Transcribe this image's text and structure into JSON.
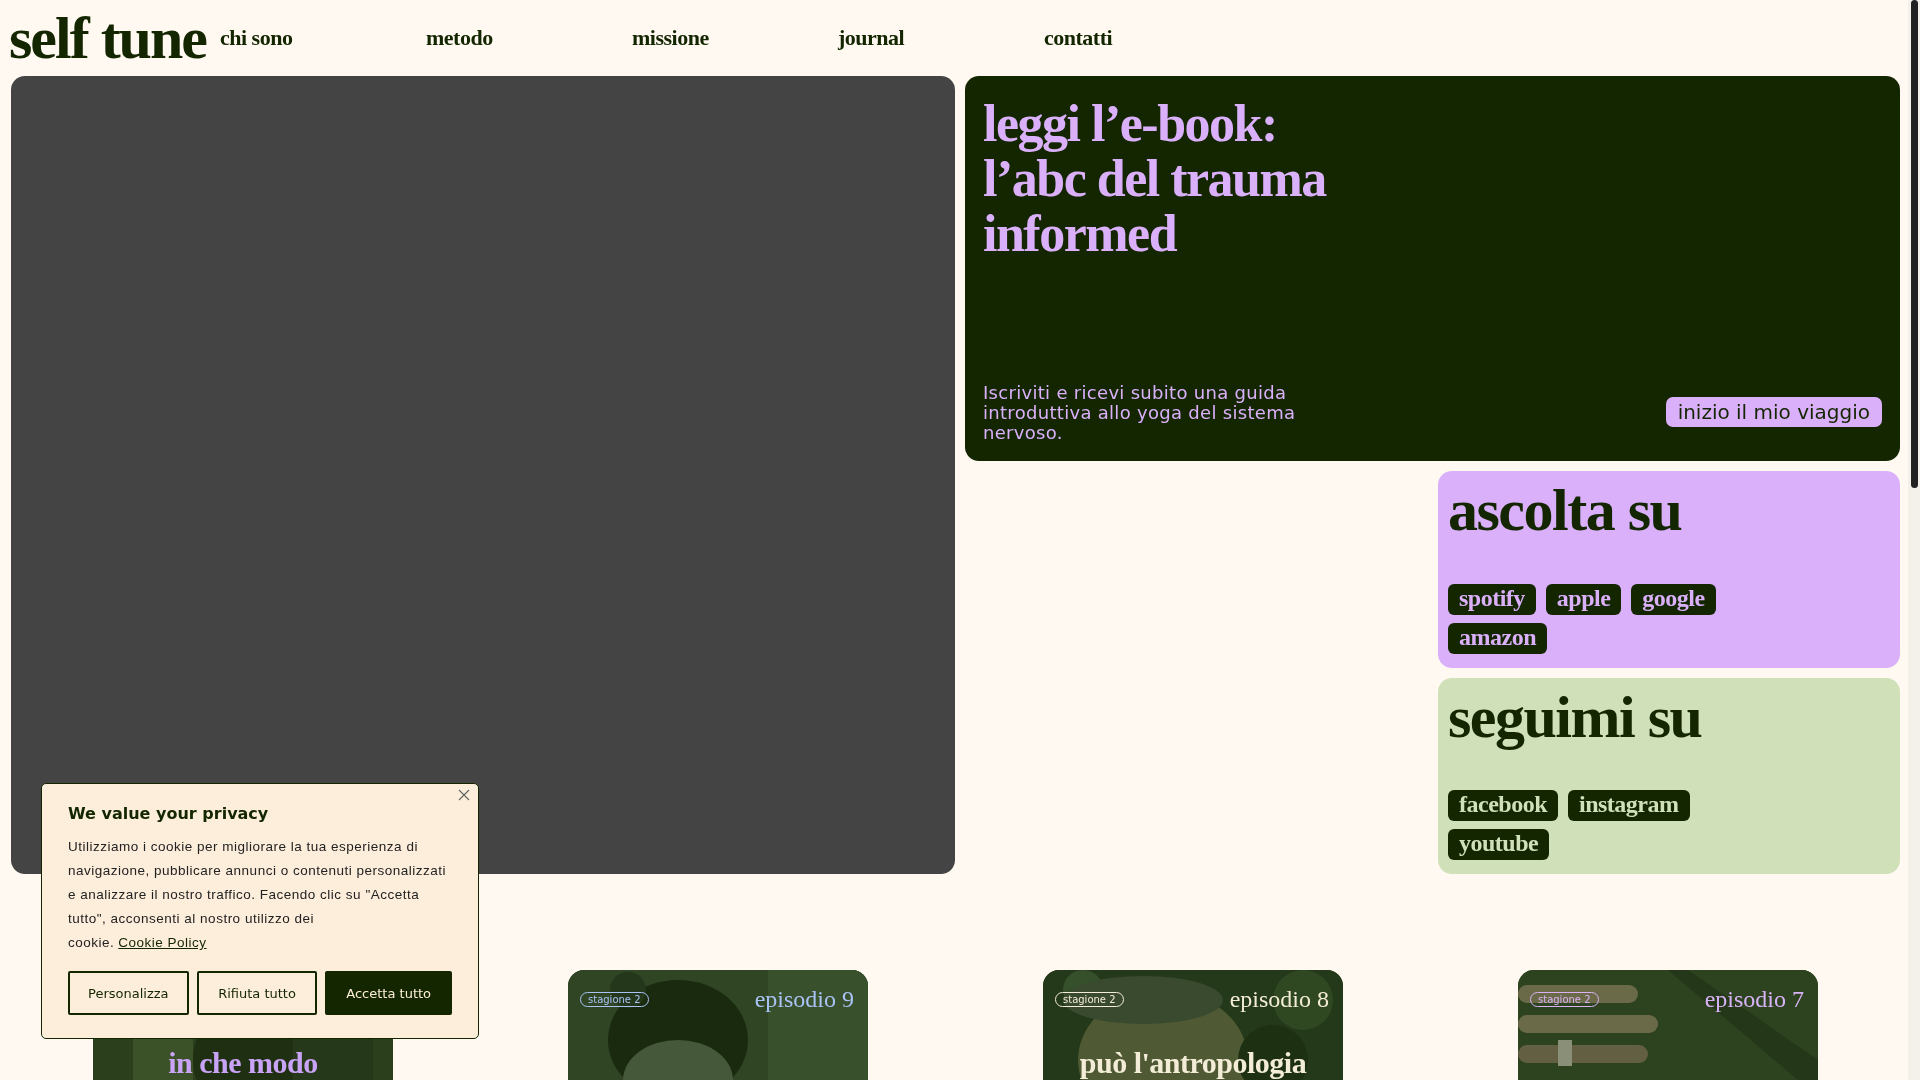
{
  "header": {
    "logo": "self tune",
    "nav": [
      "chi sono",
      "metodo",
      "missione",
      "journal",
      "contatti"
    ]
  },
  "ebook": {
    "title_lines": [
      "leggi l’e-book:",
      "l’abc del trauma",
      "informed"
    ],
    "text": "Iscriviti e ricevi subito una guida introduttiva allo yoga del sistema nervoso.",
    "button": "inizio il mio viaggio"
  },
  "link_cards": [
    {
      "title": "ascolta su",
      "color": "#dbb0fb",
      "links": [
        "spotify",
        "apple",
        "google",
        "amazon"
      ]
    },
    {
      "title": "seguimi su",
      "color": "#d0e0b9",
      "links": [
        "facebook",
        "instagram",
        "youtube"
      ]
    }
  ],
  "episodes": [
    {
      "title": "in che modo",
      "color": "#c9a3f5"
    },
    {
      "badge": "stagione 2",
      "number": "episodio 9",
      "color": "#a9c3f5"
    },
    {
      "badge": "stagione 2",
      "number": "episodio 8",
      "color": "#f3ecd6",
      "title": "può l'antropologia"
    },
    {
      "badge": "stagione 2",
      "number": "episodio 7",
      "color": "#d9b3f7"
    }
  ],
  "cookie_banner": {
    "title": "We value your privacy",
    "text": "Utilizziamo i cookie per migliorare la tua esperienza di navigazione, pubblicare annunci o contenuti personalizzati e analizzare il nostro traffico. Facendo clic su \"Accetta tutto\", acconsenti al nostro utilizzo dei cookie.",
    "link": "Cookie Policy",
    "buttons": [
      {
        "label": "Personalizza",
        "kind": "outline"
      },
      {
        "label": "Rifiuta tutto",
        "kind": "outline"
      },
      {
        "label": "Accetta tutto",
        "kind": "solid"
      }
    ]
  }
}
